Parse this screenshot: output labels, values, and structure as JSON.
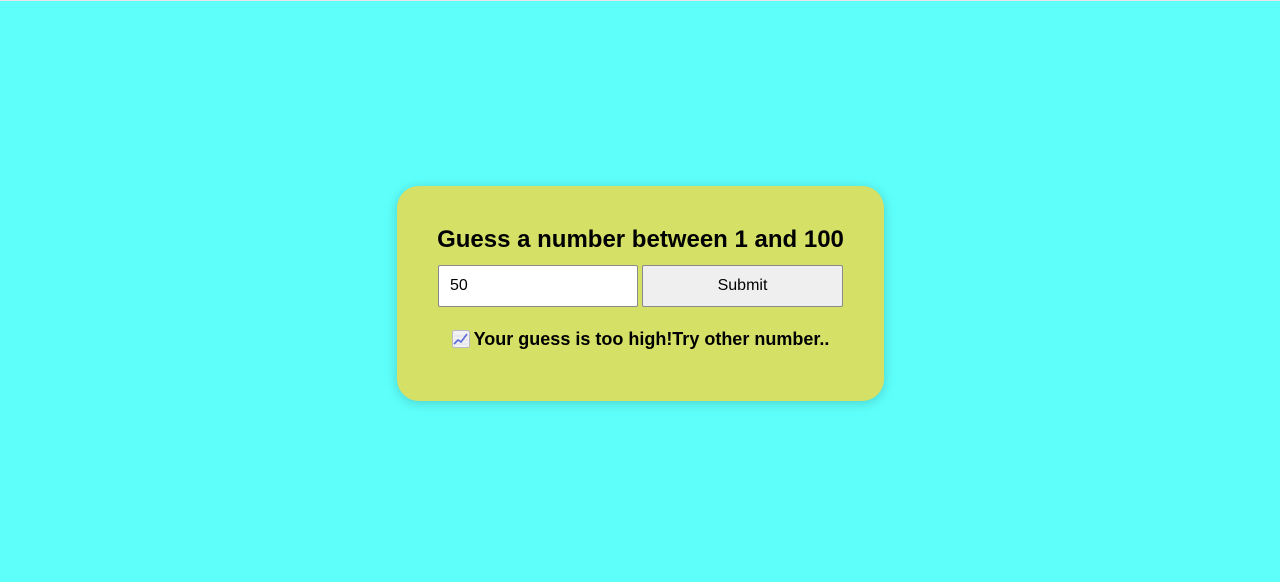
{
  "game": {
    "title": "Guess a number between 1 and 100",
    "guess_input": {
      "value": "50",
      "placeholder": ""
    },
    "submit_label": "Submit",
    "feedback": {
      "icon": "chart-increasing-icon",
      "text": "Your guess is too high!Try other number.."
    }
  },
  "colors": {
    "page_background": "#5efffa",
    "card_background": "#d5e066",
    "button_background": "#efefef"
  }
}
